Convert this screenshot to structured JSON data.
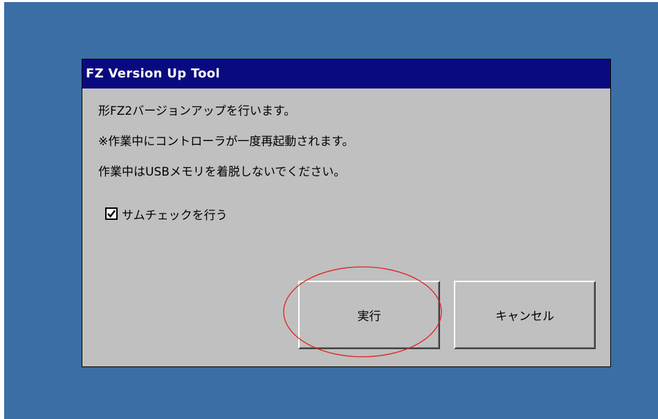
{
  "dialog": {
    "title": "FZ Version Up Tool",
    "messages": [
      "形FZ2バージョンアップを行います。",
      "※作業中にコントローラが一度再起動されます。",
      "作業中はUSBメモリを着脱しないでください。"
    ],
    "checksum": {
      "label": "サムチェックを行う",
      "checked": true
    },
    "buttons": {
      "execute_label": "実行",
      "cancel_label": "キャンセル"
    }
  },
  "colors": {
    "desktop": "#3a6ea5",
    "titlebar": "#0a0a80",
    "dialog_bg": "#c0c0c0",
    "annotation": "#e02020"
  }
}
